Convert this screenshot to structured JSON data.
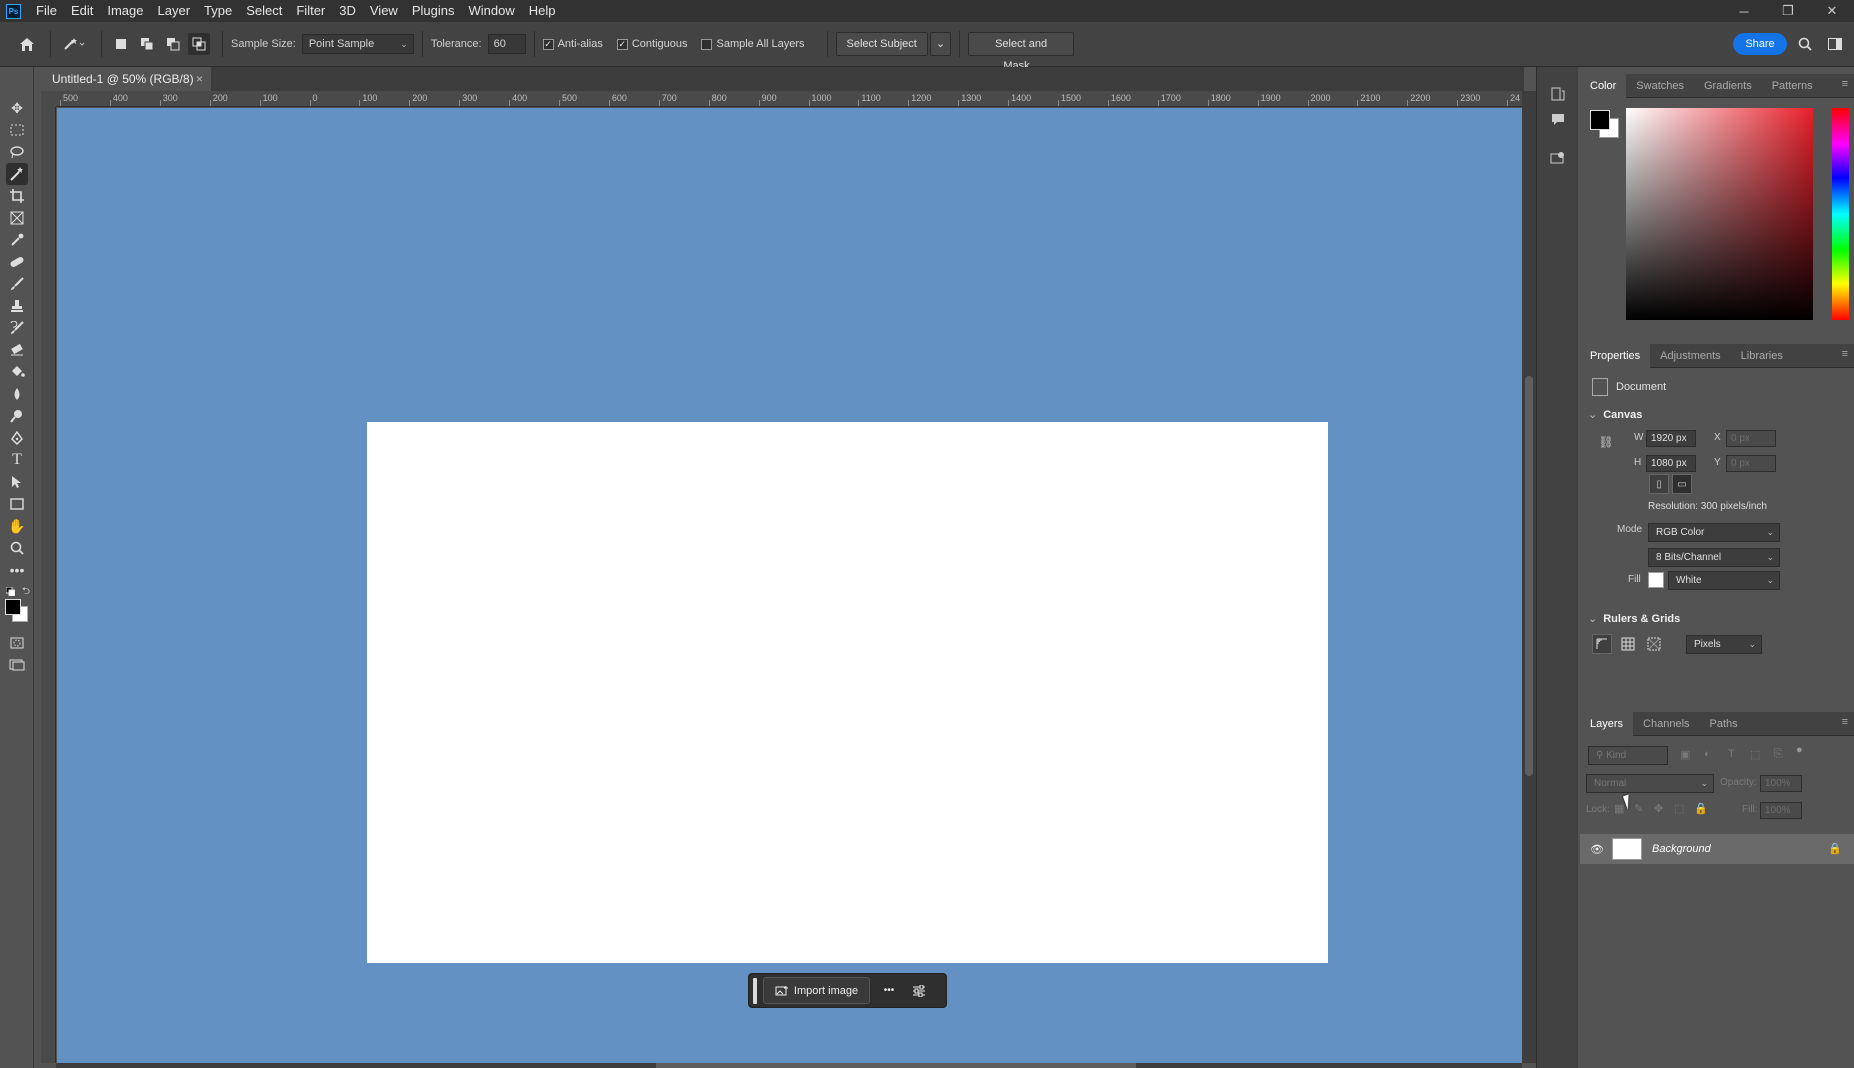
{
  "app": {
    "logo": "Ps"
  },
  "menu": [
    "File",
    "Edit",
    "Image",
    "Layer",
    "Type",
    "Select",
    "Filter",
    "3D",
    "View",
    "Plugins",
    "Window",
    "Help"
  ],
  "window_controls": {
    "minimize": "─",
    "restore": "❐",
    "close": "✕"
  },
  "options": {
    "sample_size_label": "Sample Size:",
    "sample_size_value": "Point Sample",
    "tolerance_label": "Tolerance:",
    "tolerance_value": "60",
    "anti_alias": "Anti-alias",
    "anti_alias_checked": true,
    "contiguous": "Contiguous",
    "contiguous_checked": true,
    "sample_all_layers": "Sample All Layers",
    "sample_all_layers_checked": false,
    "select_subject": "Select Subject",
    "select_and_mask": "Select and Mask...",
    "share": "Share"
  },
  "document": {
    "tab_title": "Untitled-1 @ 50% (RGB/8)"
  },
  "ruler_top": [
    "500",
    "400",
    "300",
    "200",
    "100",
    "0",
    "100",
    "200",
    "300",
    "400",
    "500",
    "600",
    "700",
    "800",
    "900",
    "1000",
    "1100",
    "1200",
    "1300",
    "1400",
    "1500",
    "1600",
    "1700",
    "1800",
    "1900",
    "2000",
    "2100",
    "2200",
    "2300",
    "24"
  ],
  "context_bar": {
    "import_label": "Import image",
    "more": "•••"
  },
  "color_panel": {
    "tabs": [
      "Color",
      "Swatches",
      "Gradients",
      "Patterns"
    ],
    "active": "Color",
    "foreground": "#000000",
    "background": "#ffffff"
  },
  "properties_panel": {
    "tabs": [
      "Properties",
      "Adjustments",
      "Libraries"
    ],
    "active": "Properties",
    "doc_label": "Document",
    "canvas_section": "Canvas",
    "w_label": "W",
    "w_value": "1920 px",
    "h_label": "H",
    "h_value": "1080 px",
    "x_label": "X",
    "x_value": "0 px",
    "y_label": "Y",
    "y_value": "0 px",
    "resolution": "Resolution: 300 pixels/inch",
    "mode_label": "Mode",
    "mode_value": "RGB Color",
    "bits_value": "8 Bits/Channel",
    "fill_label": "Fill",
    "fill_value": "White",
    "rulers_section": "Rulers & Grids",
    "units_value": "Pixels"
  },
  "layers_panel": {
    "tabs": [
      "Layers",
      "Channels",
      "Paths"
    ],
    "active": "Layers",
    "kind_placeholder": "Kind",
    "blend_mode": "Normal",
    "opacity_label": "Opacity:",
    "opacity_value": "100%",
    "lock_label": "Lock:",
    "fill_label": "Fill:",
    "fill_value": "100%",
    "layers": [
      {
        "name": "Background",
        "visible": true,
        "locked": true
      }
    ]
  }
}
